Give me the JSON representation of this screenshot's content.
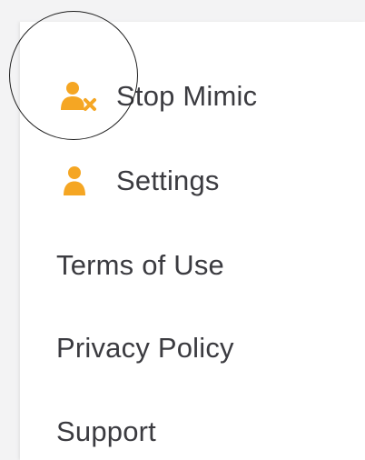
{
  "colors": {
    "accent": "#f5a623",
    "text": "#3b3b40",
    "panel": "#ffffff",
    "backdrop": "#f3f3f4"
  },
  "menu": {
    "items": [
      {
        "label": "Stop Mimic",
        "icon": "user-remove-icon"
      },
      {
        "label": "Settings",
        "icon": "user-icon"
      },
      {
        "label": "Terms of Use"
      },
      {
        "label": "Privacy Policy"
      },
      {
        "label": "Support"
      }
    ]
  }
}
